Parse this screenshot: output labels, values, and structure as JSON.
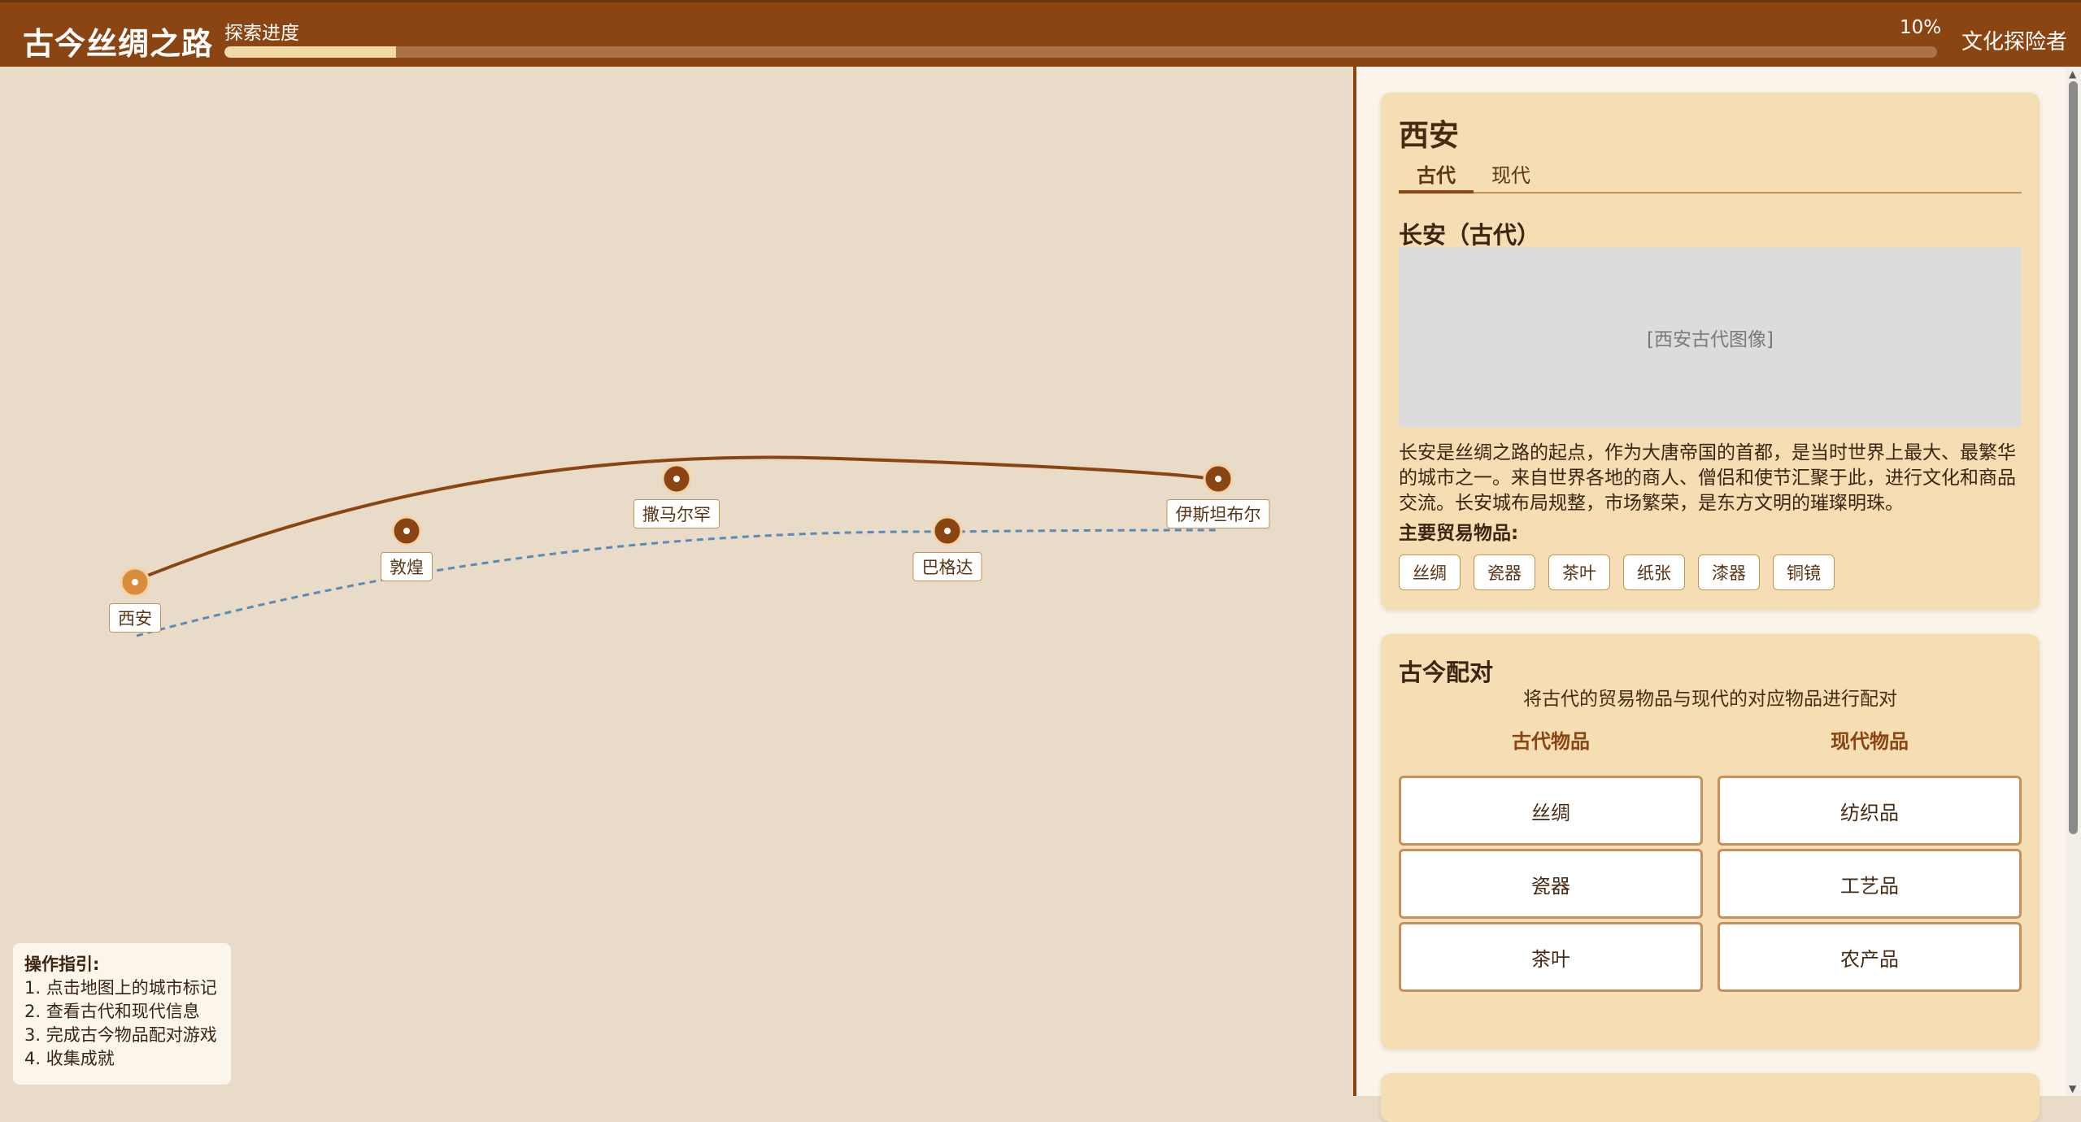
{
  "header": {
    "title": "古今丝绸之路",
    "progress_label": "探索进度",
    "progress_value": 0.1,
    "progress_text": "10%",
    "user_label": "文化探险者"
  },
  "map": {
    "cities": [
      {
        "name": "西安",
        "selected": true
      },
      {
        "name": "敦煌"
      },
      {
        "name": "撒马尔罕"
      },
      {
        "name": "巴格达"
      },
      {
        "name": "伊斯坦布尔"
      }
    ],
    "ancient_route_color": "#8b4513",
    "modern_route_color": "#5b8ab5"
  },
  "guide": {
    "title": "操作指引:",
    "steps": [
      "1. 点击地图上的城市标记",
      "2. 查看古代和现代信息",
      "3. 完成古今物品配对游戏",
      "4. 收集成就"
    ]
  },
  "city_panel": {
    "city_name": "西安",
    "tabs": [
      {
        "label": "古代",
        "active": true
      },
      {
        "label": "现代",
        "active": false
      }
    ],
    "section_title": "长安（古代）",
    "image_placeholder": "[西安古代图像]",
    "description": "长安是丝绸之路的起点，作为大唐帝国的首都，是当时世界上最大、最繁华的城市之一。来自世界各地的商人、僧侣和使节汇聚于此，进行文化和商品交流。长安城布局规整，市场繁荣，是东方文明的璀璨明珠。",
    "goods_title": "主要贸易物品:",
    "goods": [
      "丝绸",
      "瓷器",
      "茶叶",
      "纸张",
      "漆器",
      "铜镜"
    ]
  },
  "matching": {
    "title": "古今配对",
    "subtitle": "将古代的贸易物品与现代的对应物品进行配对",
    "ancient_header": "古代物品",
    "modern_header": "现代物品",
    "ancient_items": [
      "丝绸",
      "瓷器",
      "茶叶"
    ],
    "modern_items": [
      "纺织品",
      "工艺品",
      "农产品"
    ]
  },
  "colors": {
    "brand": "#8b4513",
    "card_bg": "#f5deb3",
    "map_bg": "#e8dbc8"
  }
}
